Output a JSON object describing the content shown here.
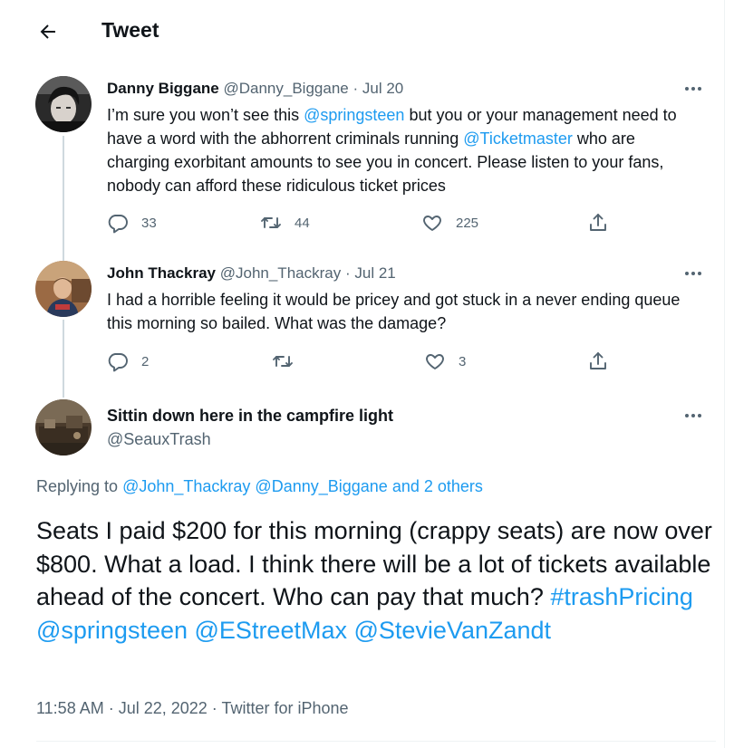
{
  "header": {
    "title": "Tweet",
    "back_icon": "arrow-left-icon"
  },
  "reply1": {
    "name": "Danny Biggane",
    "handle": "@Danny_Biggane",
    "sep": "·",
    "date": "Jul 20",
    "text_part1": "I’m sure you won’t see this ",
    "mention1": "@springsteen",
    "text_part2": " but you or your management need to have a word with the abhorrent criminals running ",
    "mention2": "@Ticketmaster",
    "text_part3": " who are charging exorbitant amounts to see you in concert. Please listen to your fans, nobody can afford these ridiculous ticket prices",
    "replies": "33",
    "retweets": "44",
    "likes": "225"
  },
  "reply2": {
    "name": "John Thackray",
    "handle": "@John_Thackray",
    "sep": "·",
    "date": "Jul 21",
    "text": "I had a horrible feeling it would be pricey and got stuck in a never ending queue this morning so bailed. What was the damage?",
    "replies": "2",
    "retweets": "",
    "likes": "3"
  },
  "main": {
    "name": "Sittin down here in the campfire light",
    "handle": "@SeauxTrash",
    "replying_prefix": "Replying to ",
    "replying_link1": "@John_Thackray",
    "replying_link2": "@Danny_Biggane",
    "replying_and": "and 2 others",
    "text": "Seats I paid $200 for this morning (crappy seats) are now over $800.  What a load.  I think there will be a lot of tickets available ahead of the concert.  Who can pay that much?  ",
    "hashtag": "#trashPricing",
    "mention1": "@springsteen",
    "mention2": "@EStreetMax",
    "mention3": "@StevieVanZandt",
    "timestamp": "11:58 AM · Jul 22, 2022 · Twitter for iPhone"
  },
  "colors": {
    "accent": "#1d9bf0",
    "muted": "#536471",
    "text": "#0f1419",
    "line": "#cfd9de"
  }
}
